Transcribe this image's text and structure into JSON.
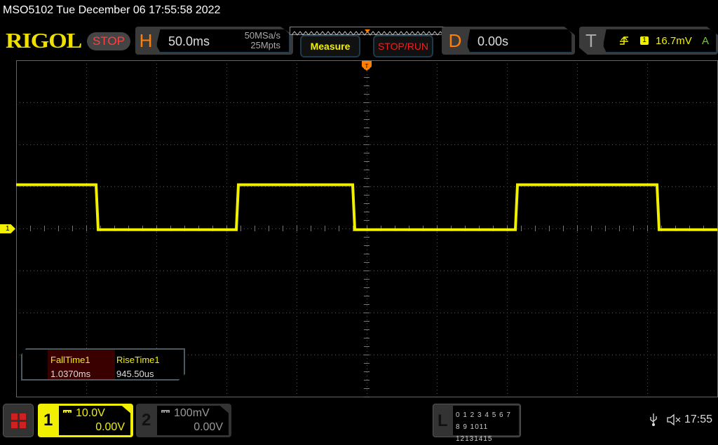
{
  "title": "MSO5102  Tue December 06 17:55:58 2022",
  "logo": "RIGOL",
  "run_state": "STOP",
  "horizontal": {
    "letter": "H",
    "timebase": "50.0ms",
    "sample_rate": "50MSa/s",
    "memory_depth": "25Mpts"
  },
  "buttons": {
    "measure": "Measure",
    "stop_run": "STOP/RUN"
  },
  "delay": {
    "letter": "D",
    "value": "0.00s"
  },
  "trigger": {
    "letter": "T",
    "source": "1",
    "level": "16.7mV",
    "mode": "A"
  },
  "channel_marker": "1",
  "measurements": [
    {
      "label": "FallTime1",
      "value": "1.0370ms"
    },
    {
      "label": "RiseTime1",
      "value": "945.50us"
    }
  ],
  "channels": [
    {
      "num": "1",
      "scale": "10.0V",
      "offset": "0.00V"
    },
    {
      "num": "2",
      "scale": "100mV",
      "offset": "0.00V"
    }
  ],
  "logic": {
    "letter": "L",
    "row1": "0 1 2 3  4 5 6 7",
    "row2": "8 9 1011 12131415"
  },
  "status": {
    "time": "17:55"
  },
  "colors": {
    "ch1": "#f0f000",
    "accent": "#ff8000"
  },
  "waveform": {
    "time_per_div_ms": 50,
    "volts_per_div": 10,
    "high_v": 10.4,
    "low_v": -0.3,
    "start_level": "high",
    "edges_ms": [
      -193,
      -93,
      -10,
      106,
      207
    ]
  }
}
